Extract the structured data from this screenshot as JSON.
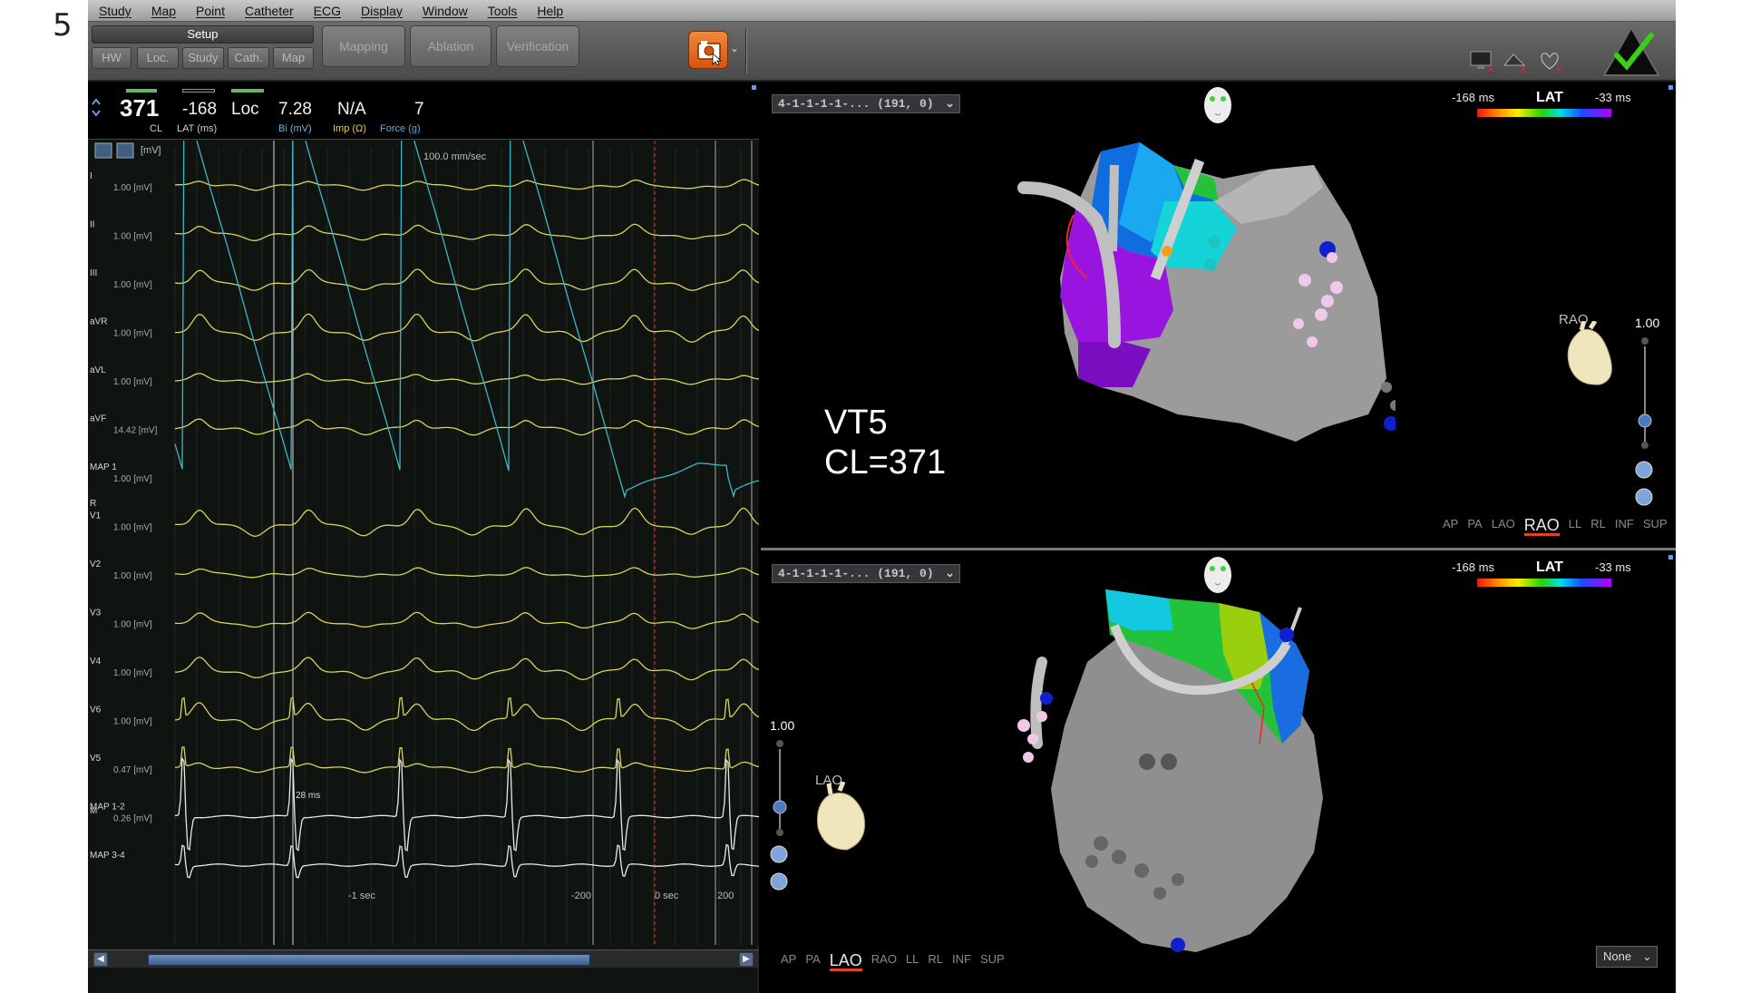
{
  "slide_number": "5",
  "menu": [
    "Study",
    "Map",
    "Point",
    "Catheter",
    "ECG",
    "Display",
    "Window",
    "Tools",
    "Help"
  ],
  "toolbar": {
    "setup_label": "Setup",
    "setup_tabs": [
      "HW",
      "Loc.",
      "Study",
      "Cath.",
      "Map"
    ],
    "phases": [
      "Mapping",
      "Ablation",
      "Verification"
    ],
    "snapshot_dropdown": "⌄"
  },
  "readout": {
    "cl_value": "371",
    "cl_label": "CL",
    "lat_value": "-168",
    "lat_label": "LAT (ms)",
    "loc_value": "Loc",
    "bi_value": "7.28",
    "bi_label": "Bi (mV)",
    "imp_value": "N/A",
    "imp_label": "Imp (Ω)",
    "force_value": "7",
    "force_label": "Force (g)"
  },
  "ecg": {
    "unit_header": "[mV]",
    "sweep_speed": "100.0 mm/sec",
    "channels": [
      {
        "name": "I",
        "scale": "1.00 [mV]",
        "color": "#d9d35a"
      },
      {
        "name": "II",
        "scale": "1.00 [mV]",
        "color": "#d9d35a"
      },
      {
        "name": "III",
        "scale": "1.00 [mV]",
        "color": "#d9d35a"
      },
      {
        "name": "aVR",
        "scale": "1.00 [mV]",
        "color": "#d9d35a"
      },
      {
        "name": "aVL",
        "scale": "1.00 [mV]",
        "color": "#d9d35a"
      },
      {
        "name": "aVF",
        "scale": "14.42 [mV]",
        "color": "#d9d35a"
      },
      {
        "name": "MAP 1",
        "scale": "1.00 [mV]",
        "color": "#3fb7c9"
      },
      {
        "name": "V1",
        "scale": "1.00 [mV]",
        "color": "#d9d35a"
      },
      {
        "name": "V2",
        "scale": "1.00 [mV]",
        "color": "#d9d35a"
      },
      {
        "name": "V3",
        "scale": "1.00 [mV]",
        "color": "#d9d35a"
      },
      {
        "name": "V4",
        "scale": "1.00 [mV]",
        "color": "#d9d35a"
      },
      {
        "name": "V6",
        "scale": "1.00 [mV]",
        "color": "#d9d35a"
      },
      {
        "name": "V5",
        "scale": "0.47 [mV]",
        "color": "#d9d35a"
      },
      {
        "name": "MAP 1-2",
        "scale": "0.26 [mV]",
        "color": "#e8e8e8"
      },
      {
        "name": "MAP 3-4",
        "scale": "",
        "color": "#e8e8e8"
      }
    ],
    "marker_r": "R",
    "marker_m": "M",
    "interval_label": "28 ms",
    "time_labels": [
      "-1 sec",
      "-200",
      "0 sec",
      "200"
    ]
  },
  "map_top": {
    "selector": "4-1-1-1-1-... (191, 0)",
    "lat_min": "-168 ms",
    "lat_label": "LAT",
    "lat_max": "-33 ms",
    "zoom": "1.00",
    "orientation": "RAO",
    "views": [
      "AP",
      "PA",
      "LAO",
      "RAO",
      "LL",
      "RL",
      "INF",
      "SUP"
    ],
    "active_view": "RAO",
    "annotation_line1": "VT5",
    "annotation_line2": "CL=371"
  },
  "map_bottom": {
    "selector": "4-1-1-1-1-... (191, 0)",
    "lat_min": "-168 ms",
    "lat_label": "LAT",
    "lat_max": "-33 ms",
    "zoom": "1.00",
    "orientation": "LAO",
    "views": [
      "AP",
      "PA",
      "LAO",
      "RAO",
      "LL",
      "RL",
      "INF",
      "SUP"
    ],
    "active_view": "LAO",
    "overlay_select": "None"
  },
  "colors": {
    "lat_early": "#ff1010",
    "lat_late": "#b400ff",
    "accent_orange": "#e0441a",
    "ecg_yellow": "#d9d35a",
    "ecg_cyan": "#3fb7c9"
  }
}
